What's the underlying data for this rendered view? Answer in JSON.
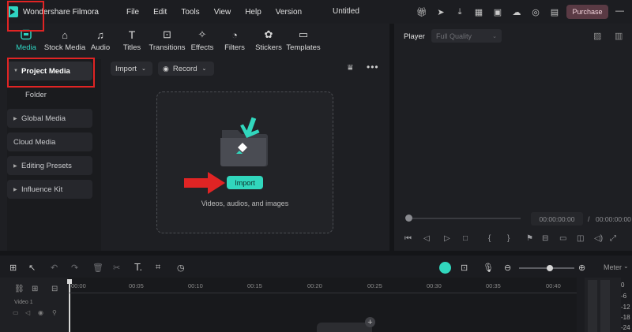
{
  "app": {
    "name": "Wondershare Filmora",
    "document_title": "Untitled",
    "purchase_label": "Purchase",
    "accent_color": "#2fd4c2",
    "highlight_color": "#e02424"
  },
  "menu": [
    "File",
    "Edit",
    "Tools",
    "View",
    "Help",
    "Version"
  ],
  "titlebar_icons": [
    "gift-icon",
    "send-icon",
    "download-icon",
    "grid-icon",
    "save-icon",
    "cloud-upload-icon",
    "headset-icon",
    "layout-icon"
  ],
  "tabs": [
    {
      "label": "Media",
      "icon": "media-icon",
      "active": true
    },
    {
      "label": "Stock Media",
      "icon": "stock-media-icon"
    },
    {
      "label": "Audio",
      "icon": "music-note-icon"
    },
    {
      "label": "Titles",
      "icon": "text-t-icon"
    },
    {
      "label": "Transitions",
      "icon": "transition-icon"
    },
    {
      "label": "Effects",
      "icon": "sparkle-icon"
    },
    {
      "label": "Filters",
      "icon": "filter-icon"
    },
    {
      "label": "Stickers",
      "icon": "sticker-icon"
    },
    {
      "label": "Templates",
      "icon": "template-icon"
    }
  ],
  "sidebar": {
    "items": [
      {
        "label": "Project Media",
        "expandable": true,
        "active": true
      },
      {
        "label": "Folder",
        "expandable": false
      },
      {
        "label": "Global Media",
        "expandable": true
      },
      {
        "label": "Cloud Media",
        "expandable": false
      },
      {
        "label": "Editing Presets",
        "expandable": true
      },
      {
        "label": "Influence Kit",
        "expandable": true
      }
    ]
  },
  "media_toolbar": {
    "import_label": "Import",
    "record_label": "Record"
  },
  "dropzone": {
    "import_button": "Import",
    "hint": "Videos, audios, and images"
  },
  "player": {
    "label": "Player",
    "quality": "Full Quality",
    "current_time": "00:00:00:00",
    "separator": "/",
    "total_time": "00:00:00:00"
  },
  "timeline": {
    "meter_label": "Meter",
    "track_label": "Video 1",
    "ruler": [
      "00:00",
      "00:05",
      "00:10",
      "00:15",
      "00:20",
      "00:25",
      "00:30",
      "00:35",
      "00:40"
    ],
    "meter_ticks": [
      "0",
      "-6",
      "-12",
      "-18",
      "-24"
    ]
  }
}
